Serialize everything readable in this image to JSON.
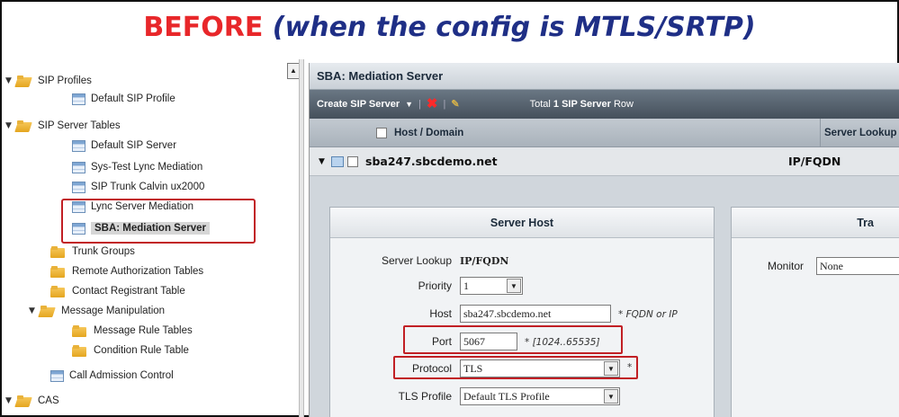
{
  "banner": {
    "red_text": "BEFORE",
    "navy_text": "(when the config is MTLS/SRTP)"
  },
  "tree": {
    "items": [
      {
        "label": "SIP Profiles"
      },
      {
        "label": "Default SIP Profile"
      },
      {
        "label": "SIP Server Tables"
      },
      {
        "label": "Default SIP Server"
      },
      {
        "label": "Sys-Test Lync Mediation"
      },
      {
        "label": "SIP Trunk Calvin ux2000"
      },
      {
        "label": "Lync Server Mediation"
      },
      {
        "label": "SBA: Mediation Server"
      },
      {
        "label": "Trunk Groups"
      },
      {
        "label": "Remote Authorization Tables"
      },
      {
        "label": "Contact Registrant Table"
      },
      {
        "label": "Message Manipulation"
      },
      {
        "label": "Message Rule Tables"
      },
      {
        "label": "Condition Rule Table"
      },
      {
        "label": "Call Admission Control"
      },
      {
        "label": "CAS"
      }
    ]
  },
  "panel": {
    "title": "SBA: Mediation Server",
    "toolbar": {
      "create_label": "Create SIP Server",
      "total_prefix": "Total",
      "total_bold": "1 SIP Server",
      "total_suffix": "Row"
    },
    "columns": {
      "host": "Host / Domain",
      "lookup": "Server Lookup"
    },
    "row": {
      "host": "sba247.sbcdemo.net",
      "lookup": "IP/FQDN"
    }
  },
  "server_host": {
    "heading": "Server Host",
    "server_lookup_label": "Server Lookup",
    "server_lookup_value": "IP/FQDN",
    "priority_label": "Priority",
    "priority_value": "1",
    "host_label": "Host",
    "host_value": "sba247.sbcdemo.net",
    "host_hint": "* FQDN or IP",
    "port_label": "Port",
    "port_value": "5067",
    "port_hint": "* [1024..65535]",
    "protocol_label": "Protocol",
    "protocol_value": "TLS",
    "protocol_hint": "*",
    "tls_profile_label": "TLS Profile",
    "tls_profile_value": "Default TLS Profile"
  },
  "transport": {
    "heading": "Tra",
    "monitor_label": "Monitor",
    "monitor_value": "None"
  },
  "colors": {
    "banner_red": "#e8272a",
    "banner_navy": "#1f2f86",
    "highlight_red": "#c11f24"
  }
}
